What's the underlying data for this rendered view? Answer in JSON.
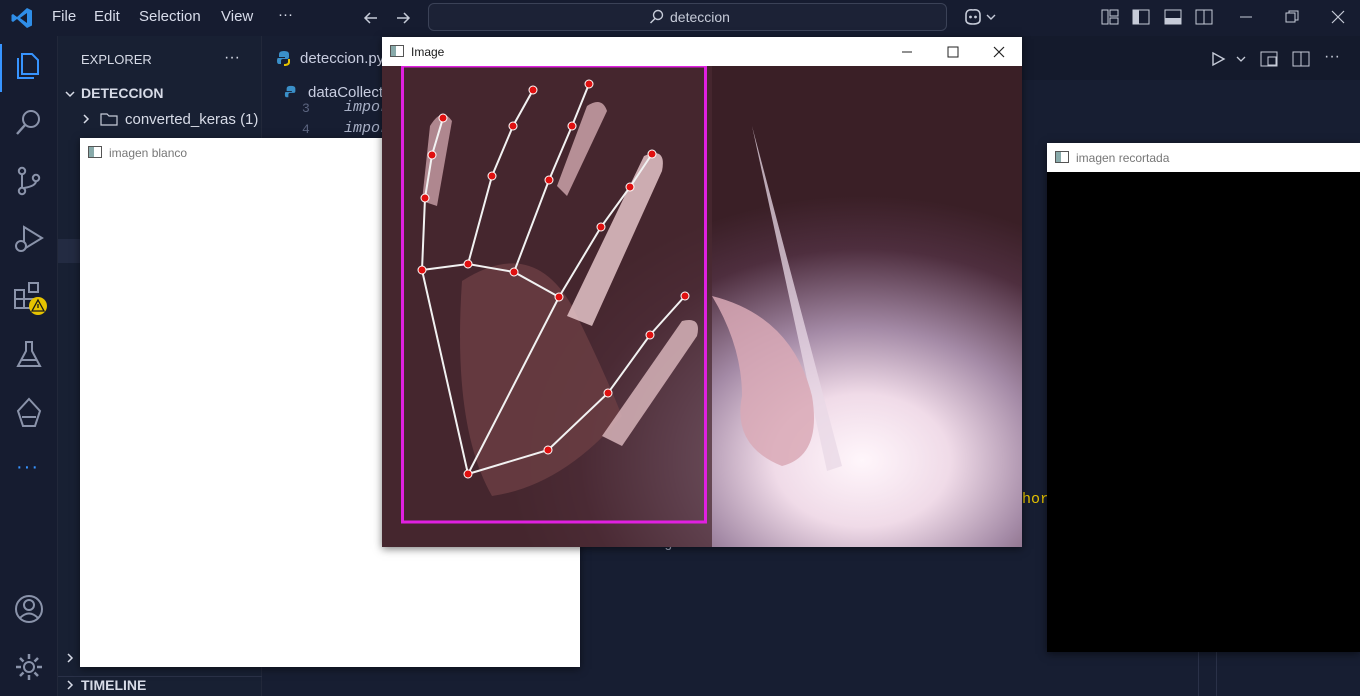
{
  "titlebar": {
    "menus": [
      "File",
      "Edit",
      "Selection",
      "View"
    ],
    "more": "···",
    "search_text": "deteccion"
  },
  "sidebar": {
    "header": "EXPLORER",
    "more": "···",
    "project": "DETECCION",
    "folder": "converted_keras (1)",
    "timeline": "TIMELINE"
  },
  "editor": {
    "tabs": [
      "deteccion.py",
      "dataCollect"
    ],
    "code_lines": [
      {
        "num": "3",
        "text": "import"
      },
      {
        "num": "4",
        "text": "import"
      }
    ],
    "partial_text": "hor",
    "partial_text2": "g"
  },
  "windows": {
    "image": {
      "title": "Image"
    },
    "blanco": {
      "title": "imagen blanco"
    },
    "recortada": {
      "title": "imagen recortada"
    }
  },
  "colors": {
    "accent": "#3794ff",
    "bounding_box": "#e020e0",
    "landmark": "#e01010",
    "warning_badge": "#e6c300"
  }
}
